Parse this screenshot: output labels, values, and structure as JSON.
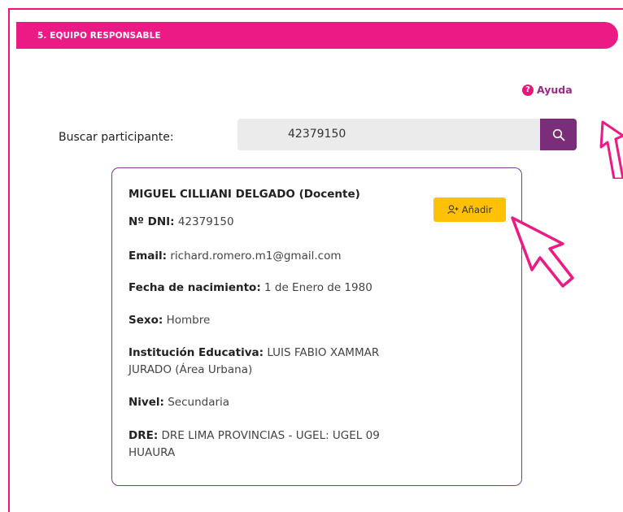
{
  "section": {
    "title": "5. EQUIPO RESPONSABLE"
  },
  "help": {
    "label": "Ayuda",
    "icon": "question-circle-icon"
  },
  "search": {
    "label": "Buscar participante:",
    "value": "42379150",
    "icon": "search-icon"
  },
  "participant": {
    "name": "MIGUEL CILLIANI DELGADO (Docente)",
    "add_label": "Añadir",
    "fields": [
      {
        "label": "Nº DNI:",
        "value": "42379150"
      },
      {
        "label": "Email:",
        "value": "richard.romero.m1@gmail.com"
      },
      {
        "label": "Fecha de nacimiento:",
        "value": "1 de Enero de 1980"
      },
      {
        "label": "Sexo:",
        "value": "Hombre"
      },
      {
        "label": "Institución Educativa:",
        "value": "LUIS FABIO XAMMAR JURADO (Área Urbana)"
      },
      {
        "label": "Nivel:",
        "value": "Secundaria"
      },
      {
        "label": "DRE:",
        "value": "DRE LIMA PROVINCIAS - UGEL: UGEL 09 HUAURA"
      }
    ]
  },
  "colors": {
    "accent": "#ec1a85",
    "primary": "#7a2d79",
    "button": "#ffc107"
  }
}
